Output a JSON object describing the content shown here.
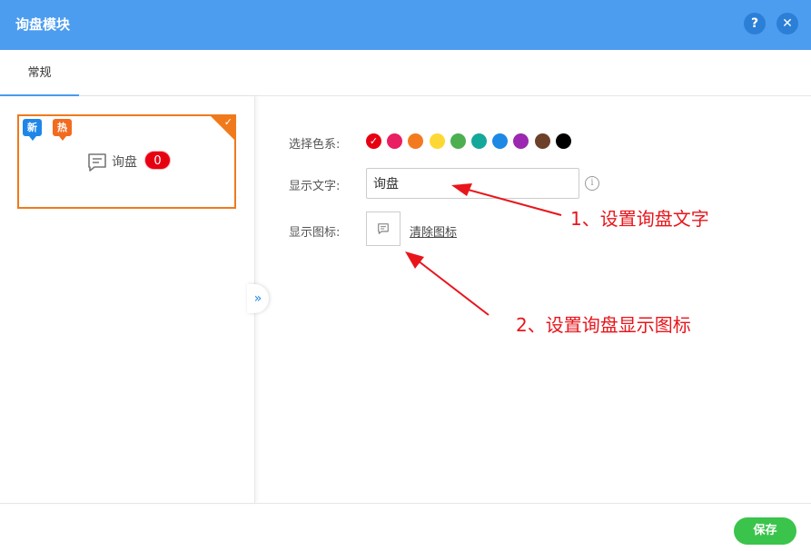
{
  "dialog": {
    "title": "询盘模块",
    "help_label": "?",
    "close_label": "✕"
  },
  "tabs": [
    {
      "label": "常规"
    }
  ],
  "preview": {
    "badge_new": "新",
    "badge_hot": "热",
    "label": "询盘",
    "count": "0",
    "icon": "chat-icon",
    "accent": "#f07a1b"
  },
  "form": {
    "color_label": "选择色系:",
    "colors": [
      "#e60012",
      "#e91e63",
      "#f47a20",
      "#fdd835",
      "#4caf50",
      "#14a89a",
      "#1e88e5",
      "#9c27b0",
      "#6d4029",
      "#000000"
    ],
    "selected_color_index": 0,
    "text_label": "显示文字:",
    "text_value": "询盘",
    "icon_label": "显示图标:",
    "clear_icon_label": "清除图标"
  },
  "annotations": {
    "note1": "1、设置询盘文字",
    "note2": "2、设置询盘显示图标",
    "color": "#e8151b"
  },
  "footer": {
    "save_label": "保存",
    "save_color": "#3bc44b"
  }
}
